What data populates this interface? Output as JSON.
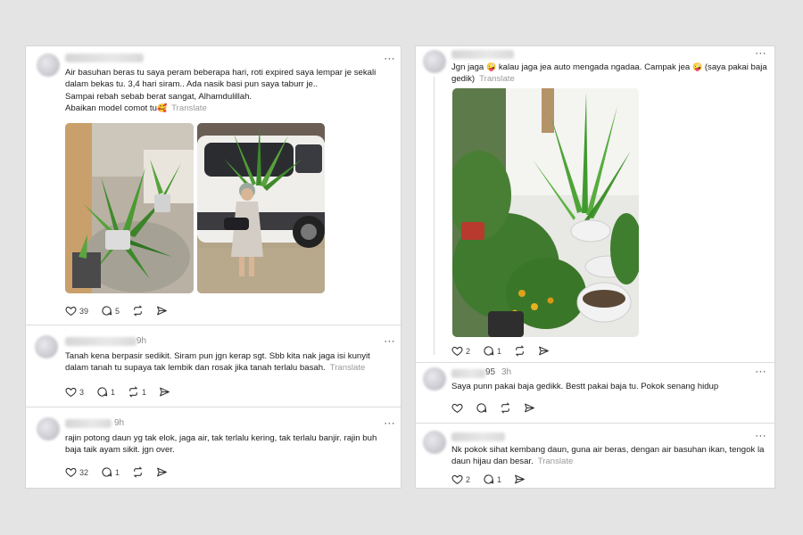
{
  "left_panel": {
    "posts": [
      {
        "time": "",
        "text": "Air basuhan beras tu saya peram beberapa hari, roti expired saya lempar je sekali dalam bekas tu. 3,4 hari siram.. Ada nasik basi pun saya taburr je..\nSampai rebah sebab berat sangat, Alhamdulillah.\nAbaikan model comot tu",
        "emoji": "🥰",
        "translate": "Translate",
        "likes": "39",
        "replies": "5"
      },
      {
        "time": "9h",
        "text": "Tanah kena berpasir sedikit. Siram pun jgn kerap sgt. Sbb kita nak jaga isi kunyit dalam tanah tu supaya tak lembik dan rosak jika tanah terlalu basah.",
        "translate": "Translate",
        "likes": "3",
        "replies": "1",
        "reposts": "1"
      },
      {
        "time": "9h",
        "text": "rajin potong daun yg tak elok, jaga air, tak terlalu kering, tak terlalu banjir. rajin buh baja taik ayam sikit. jgn over.",
        "likes": "32",
        "replies": "1"
      }
    ]
  },
  "right_panel": {
    "posts": [
      {
        "text_a": "Jgn jaga",
        "emoji": "🤪",
        "text_b": "kalau jaga jea auto mengada ngadaa. Campak jea",
        "text_c": "(saya pakai baja gedik)",
        "translate": "Translate",
        "likes": "2",
        "replies": "1"
      },
      {
        "user_suffix": "95",
        "time": "3h",
        "text": "Saya punn pakai baja gedikk. Bestt pakai baja tu. Pokok senang hidup"
      },
      {
        "text": "Nk pokok sihat kembang daun, guna air beras, dengan air basuhan ikan, tengok la daun hijau dan besar.",
        "translate": "Translate",
        "likes": "2",
        "replies": "1"
      }
    ]
  },
  "icons": {
    "like": "heart-icon",
    "reply": "comment-icon",
    "repost": "repost-icon",
    "share": "send-icon",
    "more": "more-dots-icon"
  },
  "colors": {
    "background": "#e4e4e4",
    "card": "#ffffff",
    "muted": "#9a9a9a",
    "text": "#1c1c1c"
  }
}
